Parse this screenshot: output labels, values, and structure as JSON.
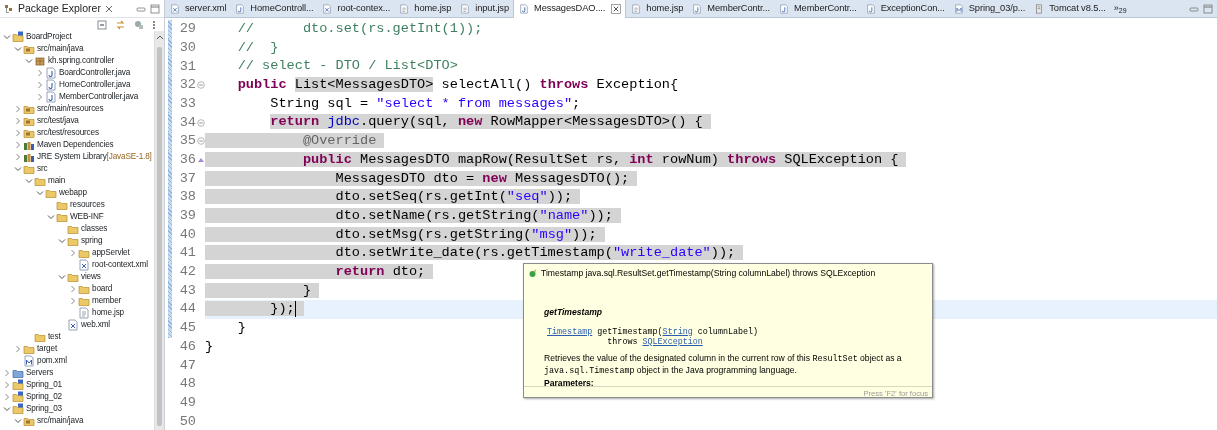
{
  "explorer": {
    "title": "Package Explorer",
    "tree": [
      {
        "label": "BoardProject",
        "kind": "project",
        "expanded": true,
        "children": [
          {
            "label": "src/main/java",
            "kind": "srcfolder",
            "expanded": true,
            "children": [
              {
                "label": "kh.spring.controller",
                "kind": "package",
                "expanded": true,
                "children": [
                  {
                    "label": "BoardController.java",
                    "kind": "java",
                    "expanded": false
                  },
                  {
                    "label": "HomeController.java",
                    "kind": "java",
                    "expanded": false
                  },
                  {
                    "label": "MemberController.java",
                    "kind": "java",
                    "expanded": false
                  }
                ]
              }
            ]
          },
          {
            "label": "src/main/resources",
            "kind": "srcfolder",
            "expanded": false
          },
          {
            "label": "src/test/java",
            "kind": "srcfolder",
            "expanded": false
          },
          {
            "label": "src/test/resources",
            "kind": "srcfolder",
            "expanded": false
          },
          {
            "label": "Maven Dependencies",
            "kind": "library",
            "expanded": false
          },
          {
            "label": "JRE System Library",
            "decoration": "[JavaSE-1.8]",
            "kind": "library",
            "expanded": false
          },
          {
            "label": "src",
            "kind": "folder",
            "expanded": true,
            "children": [
              {
                "label": "main",
                "kind": "folder",
                "expanded": true,
                "children": [
                  {
                    "label": "webapp",
                    "kind": "folder",
                    "expanded": true,
                    "children": [
                      {
                        "label": "resources",
                        "kind": "folder"
                      },
                      {
                        "label": "WEB-INF",
                        "kind": "folder",
                        "expanded": true,
                        "children": [
                          {
                            "label": "classes",
                            "kind": "folder"
                          },
                          {
                            "label": "spring",
                            "kind": "folder",
                            "expanded": true,
                            "children": [
                              {
                                "label": "appServlet",
                                "kind": "folder",
                                "expanded": false
                              },
                              {
                                "label": "root-context.xml",
                                "kind": "xml"
                              }
                            ]
                          },
                          {
                            "label": "views",
                            "kind": "folder",
                            "expanded": true,
                            "children": [
                              {
                                "label": "board",
                                "kind": "folder",
                                "expanded": false
                              },
                              {
                                "label": "member",
                                "kind": "folder",
                                "expanded": false
                              },
                              {
                                "label": "home.jsp",
                                "kind": "jsp"
                              }
                            ]
                          },
                          {
                            "label": "web.xml",
                            "kind": "xml"
                          }
                        ]
                      }
                    ]
                  }
                ]
              },
              {
                "label": "test",
                "kind": "folder"
              }
            ]
          },
          {
            "label": "target",
            "kind": "folder",
            "expanded": false
          },
          {
            "label": "pom.xml",
            "kind": "maven"
          }
        ]
      },
      {
        "label": "Servers",
        "kind": "servers",
        "expanded": false
      },
      {
        "label": "Spring_01",
        "kind": "project",
        "expanded": false
      },
      {
        "label": "Spring_02",
        "kind": "project",
        "expanded": false
      },
      {
        "label": "Spring_03",
        "kind": "project",
        "expanded": true,
        "children": [
          {
            "label": "src/main/java",
            "kind": "srcfolder",
            "expanded": true
          }
        ]
      }
    ]
  },
  "tabs": [
    {
      "label": "server.xml",
      "kind": "xml",
      "selected": false
    },
    {
      "label": "HomeControll...",
      "kind": "java",
      "selected": false
    },
    {
      "label": "root-contex...",
      "kind": "xml",
      "selected": false
    },
    {
      "label": "home.jsp",
      "kind": "jsp",
      "selected": false
    },
    {
      "label": "input.jsp",
      "kind": "jsp",
      "selected": false
    },
    {
      "label": "MessagesDAO....",
      "kind": "java",
      "selected": true
    },
    {
      "label": "home.jsp",
      "kind": "jsp",
      "selected": false
    },
    {
      "label": "MemberContr...",
      "kind": "java",
      "selected": false
    },
    {
      "label": "MemberContr...",
      "kind": "java",
      "selected": false
    },
    {
      "label": "ExceptionCon...",
      "kind": "java",
      "selected": false
    },
    {
      "label": "Spring_03/p...",
      "kind": "maven",
      "selected": false
    },
    {
      "label": "Tomcat v8.5...",
      "kind": "server",
      "selected": false
    }
  ],
  "tab_overflow": {
    "chevron": "»",
    "count": "29"
  },
  "code": [
    {
      "number": "29",
      "changed": true,
      "tokens": [
        {
          "kind": "comment",
          "text": "    //      dto.set(rs.getInt(1));"
        }
      ]
    },
    {
      "number": "30",
      "changed": true,
      "tokens": [
        {
          "kind": "comment",
          "text": "    //  }"
        }
      ]
    },
    {
      "number": "31",
      "changed": true,
      "tokens": [
        {
          "kind": "comment",
          "text": "    // select - DTO / List<DTO>"
        }
      ]
    },
    {
      "number": "32",
      "changed": true,
      "foldable": true,
      "tokens": [
        {
          "kind": "keyword",
          "text": "    public "
        },
        {
          "kind": "plain",
          "text": "List<MessagesDTO>",
          "highlight": true
        },
        {
          "kind": "plain",
          "text": " selectAll() "
        },
        {
          "kind": "keyword",
          "text": "throws"
        },
        {
          "kind": "plain",
          "text": " Exception{"
        }
      ]
    },
    {
      "number": "33",
      "changed": true,
      "tokens": [
        {
          "kind": "plain",
          "text": "        String sql = "
        },
        {
          "kind": "string",
          "text": "\"select * from messages\""
        },
        {
          "kind": "plain",
          "text": ";"
        }
      ]
    },
    {
      "number": "34",
      "changed": true,
      "foldable": true,
      "selected": true,
      "indent_selected": false,
      "tokens": [
        {
          "kind": "keyword",
          "text": "        return "
        },
        {
          "kind": "field",
          "text": "jdbc"
        },
        {
          "kind": "plain",
          "text": ".query(sql, "
        },
        {
          "kind": "keyword",
          "text": "new"
        },
        {
          "kind": "plain",
          "text": " RowMapper<MessagesDTO>() {"
        }
      ]
    },
    {
      "number": "35",
      "changed": true,
      "foldable": true,
      "selected": true,
      "indent_selected": true,
      "tokens": [
        {
          "kind": "annotation",
          "text": "            @Override"
        }
      ]
    },
    {
      "number": "36",
      "changed": true,
      "overrides": true,
      "selected": true,
      "indent_selected": true,
      "tokens": [
        {
          "kind": "keyword",
          "text": "            public"
        },
        {
          "kind": "plain",
          "text": " MessagesDTO mapRow(ResultSet rs, "
        },
        {
          "kind": "keyword",
          "text": "int"
        },
        {
          "kind": "plain",
          "text": " rowNum) "
        },
        {
          "kind": "keyword",
          "text": "throws"
        },
        {
          "kind": "plain",
          "text": " SQLException {"
        }
      ]
    },
    {
      "number": "37",
      "changed": true,
      "selected": true,
      "indent_selected": true,
      "tokens": [
        {
          "kind": "plain",
          "text": "                MessagesDTO dto = "
        },
        {
          "kind": "keyword",
          "text": "new"
        },
        {
          "kind": "plain",
          "text": " MessagesDTO();"
        }
      ]
    },
    {
      "number": "38",
      "changed": true,
      "selected": true,
      "indent_selected": true,
      "tokens": [
        {
          "kind": "plain",
          "text": "                dto.setSeq(rs.getInt("
        },
        {
          "kind": "string",
          "text": "\"seq\""
        },
        {
          "kind": "plain",
          "text": "));"
        }
      ]
    },
    {
      "number": "39",
      "changed": true,
      "selected": true,
      "indent_selected": true,
      "tokens": [
        {
          "kind": "plain",
          "text": "                dto.setName(rs.getString("
        },
        {
          "kind": "string",
          "text": "\"name\""
        },
        {
          "kind": "plain",
          "text": "));"
        }
      ]
    },
    {
      "number": "40",
      "changed": true,
      "selected": true,
      "indent_selected": true,
      "tokens": [
        {
          "kind": "plain",
          "text": "                dto.setMsg(rs.getString("
        },
        {
          "kind": "string",
          "text": "\"msg\""
        },
        {
          "kind": "plain",
          "text": "));"
        }
      ]
    },
    {
      "number": "41",
      "changed": true,
      "selected": true,
      "indent_selected": true,
      "tokens": [
        {
          "kind": "plain",
          "text": "                dto.setWrite_date(rs.getTimestamp("
        },
        {
          "kind": "string",
          "text": "\"write_date\""
        },
        {
          "kind": "plain",
          "text": "));"
        }
      ]
    },
    {
      "number": "42",
      "changed": true,
      "selected": true,
      "indent_selected": true,
      "tokens": [
        {
          "kind": "keyword",
          "text": "                return"
        },
        {
          "kind": "plain",
          "text": " dto;"
        }
      ]
    },
    {
      "number": "43",
      "changed": true,
      "selected": true,
      "indent_selected": true,
      "tokens": [
        {
          "kind": "plain",
          "text": "            }"
        }
      ]
    },
    {
      "number": "44",
      "changed": true,
      "current": true,
      "selected": true,
      "indent_selected": true,
      "tokens": [
        {
          "kind": "plain",
          "text": "        });"
        }
      ]
    },
    {
      "number": "45",
      "changed": true,
      "tokens": [
        {
          "kind": "plain",
          "text": "    }"
        }
      ]
    },
    {
      "number": "46",
      "changed": false,
      "tokens": [
        {
          "kind": "plain",
          "text": "}"
        }
      ]
    },
    {
      "number": "47",
      "changed": false
    },
    {
      "number": "48",
      "changed": false
    },
    {
      "number": "49",
      "changed": false
    },
    {
      "number": "50",
      "changed": false
    }
  ],
  "hover": {
    "header": "Timestamp java.sql.ResultSet.getTimestamp(String columnLabel) throws SQLException",
    "method_name": "getTimestamp",
    "signature": [
      [
        {
          "kind": "link",
          "text": "Timestamp"
        },
        {
          "kind": "text",
          "text": " getTimestamp("
        },
        {
          "kind": "link",
          "text": "String"
        },
        {
          "kind": "text",
          "text": " columnLabel)"
        }
      ],
      [
        {
          "kind": "text",
          "text": "            throws "
        },
        {
          "kind": "link",
          "text": "SQLException"
        }
      ]
    ],
    "description": [
      {
        "kind": "text",
        "text": "Retrieves the value of the designated column in the current row of this "
      },
      {
        "kind": "code",
        "text": "ResultSet"
      },
      {
        "kind": "text",
        "text": " object as a "
      },
      {
        "kind": "code",
        "text": "java.sql.Timestamp"
      },
      {
        "kind": "text",
        "text": " object in the Java programming language."
      }
    ],
    "params_label": "Parameters:",
    "footer": "Press 'F2' for focus"
  }
}
